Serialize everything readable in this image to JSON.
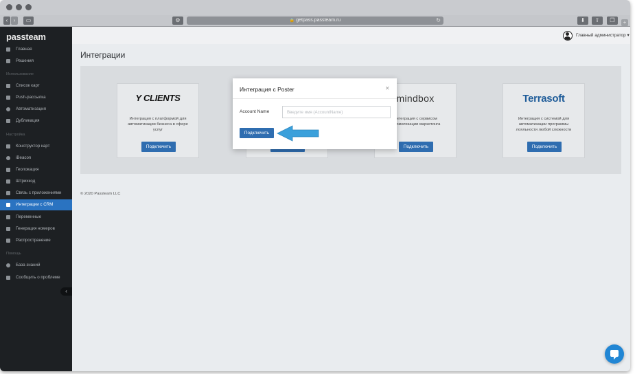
{
  "browser": {
    "url": "getpass.passteam.ru"
  },
  "sidebar": {
    "logo": "passteam",
    "items": [
      {
        "label": "Главная",
        "icon": "home-icon"
      },
      {
        "label": "Решения",
        "icon": "list-icon"
      },
      {
        "label": "Использование",
        "type": "section"
      },
      {
        "label": "Список карт",
        "icon": "list-icon"
      },
      {
        "label": "Push-рассылка",
        "icon": "megaphone-icon"
      },
      {
        "label": "Автоматизация",
        "icon": "clock-icon"
      },
      {
        "label": "Дубликация",
        "icon": "copy-icon"
      },
      {
        "label": "Настройка",
        "type": "section"
      },
      {
        "label": "Конструктор карт",
        "icon": "brush-icon"
      },
      {
        "label": "iBeacon",
        "icon": "beacon-icon"
      },
      {
        "label": "Геолокация",
        "icon": "location-icon"
      },
      {
        "label": "Штрихкод",
        "icon": "barcode-icon"
      },
      {
        "label": "Связь с приложениями",
        "icon": "link-icon"
      },
      {
        "label": "Интеграции с CRM",
        "icon": "sitemap-icon",
        "active": true
      },
      {
        "label": "Переменные",
        "icon": "variables-icon"
      },
      {
        "label": "Генерация номеров",
        "icon": "grid-icon"
      },
      {
        "label": "Распространение",
        "icon": "share-icon"
      },
      {
        "label": "Помощь",
        "type": "section"
      },
      {
        "label": "База знаний",
        "icon": "lifebuoy-icon"
      },
      {
        "label": "Сообщить о проблеме",
        "icon": "bug-icon"
      }
    ]
  },
  "header": {
    "user_name": "Главный администратор"
  },
  "main": {
    "title": "Интеграции",
    "cards": [
      {
        "logo": "Y CLIENTS",
        "desc": "Интеграция с платформой для автоматизации бизнеса в сфере услуг",
        "button": "Подключить"
      },
      {
        "logo": "",
        "desc": "",
        "button": "Подключить"
      },
      {
        "logo": "mindbox",
        "desc": "Интеграция с сервисом автоматизации маркетинга",
        "button": "Подключить"
      },
      {
        "logo": "Terrasoft",
        "desc": "Интеграция с системой для автоматизации программы лояльности любой сложности",
        "button": "Подключить"
      }
    ],
    "copyright": "© 2020 Passteam LLC"
  },
  "modal": {
    "title": "Интеграция с Poster",
    "field_label": "Account Name",
    "field_placeholder": "Введите имя (AccountName)",
    "field_value": "",
    "submit": "Подключить"
  },
  "colors": {
    "accent": "#2f6db0",
    "sidebar_bg": "#1d2023",
    "active_item": "#2a73c1",
    "annotation_arrow": "#3aa0db"
  }
}
